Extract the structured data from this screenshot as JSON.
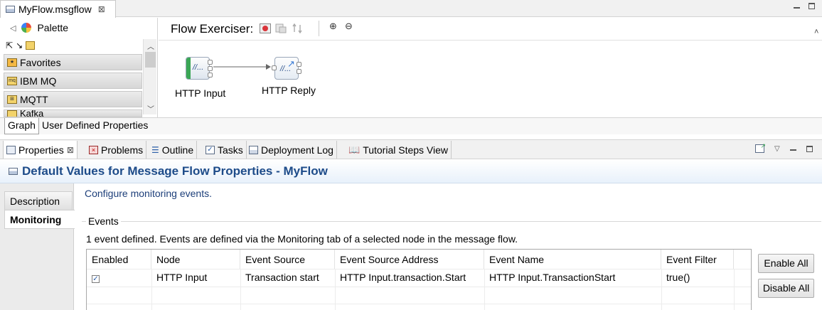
{
  "editor": {
    "tab_title": "MyFlow.msgflow",
    "close_glyph": "⊠",
    "subtabs": [
      "Graph",
      "User Defined Properties"
    ]
  },
  "palette": {
    "title": "Palette",
    "drawers": [
      "Favorites",
      "IBM MQ",
      "MQTT",
      "Kafka"
    ]
  },
  "canvas": {
    "flow_exerciser_label": "Flow Exerciser:",
    "nodes": [
      {
        "label": "HTTP Input",
        "icon_text": "//..."
      },
      {
        "label": "HTTP Reply",
        "icon_text": "//..."
      }
    ]
  },
  "views": {
    "tabs": [
      "Properties",
      "Problems",
      "Outline",
      "Tasks",
      "Deployment Log",
      "Tutorial Steps View"
    ]
  },
  "properties": {
    "title": "Default Values for Message Flow Properties - MyFlow",
    "side_tabs": [
      "Description",
      "Monitoring"
    ],
    "description": "Configure monitoring events.",
    "events_group_label": "Events",
    "events_info": "1 event defined.  Events are defined via the Monitoring tab of a selected node in the message flow.",
    "columns": [
      "Enabled",
      "Node",
      "Event Source",
      "Event Source Address",
      "Event Name",
      "Event Filter"
    ],
    "rows": [
      {
        "enabled_glyph": "✓",
        "node": "HTTP Input",
        "event_source": "Transaction start",
        "event_source_address": "HTTP Input.transaction.Start",
        "event_name": "HTTP Input.TransactionStart",
        "event_filter": "true()"
      }
    ],
    "enable_all_label": "Enable All",
    "disable_all_label": "Disable All"
  },
  "colors": {
    "title_blue": "#1d4b89",
    "description_blue": "#1d3f7a"
  }
}
